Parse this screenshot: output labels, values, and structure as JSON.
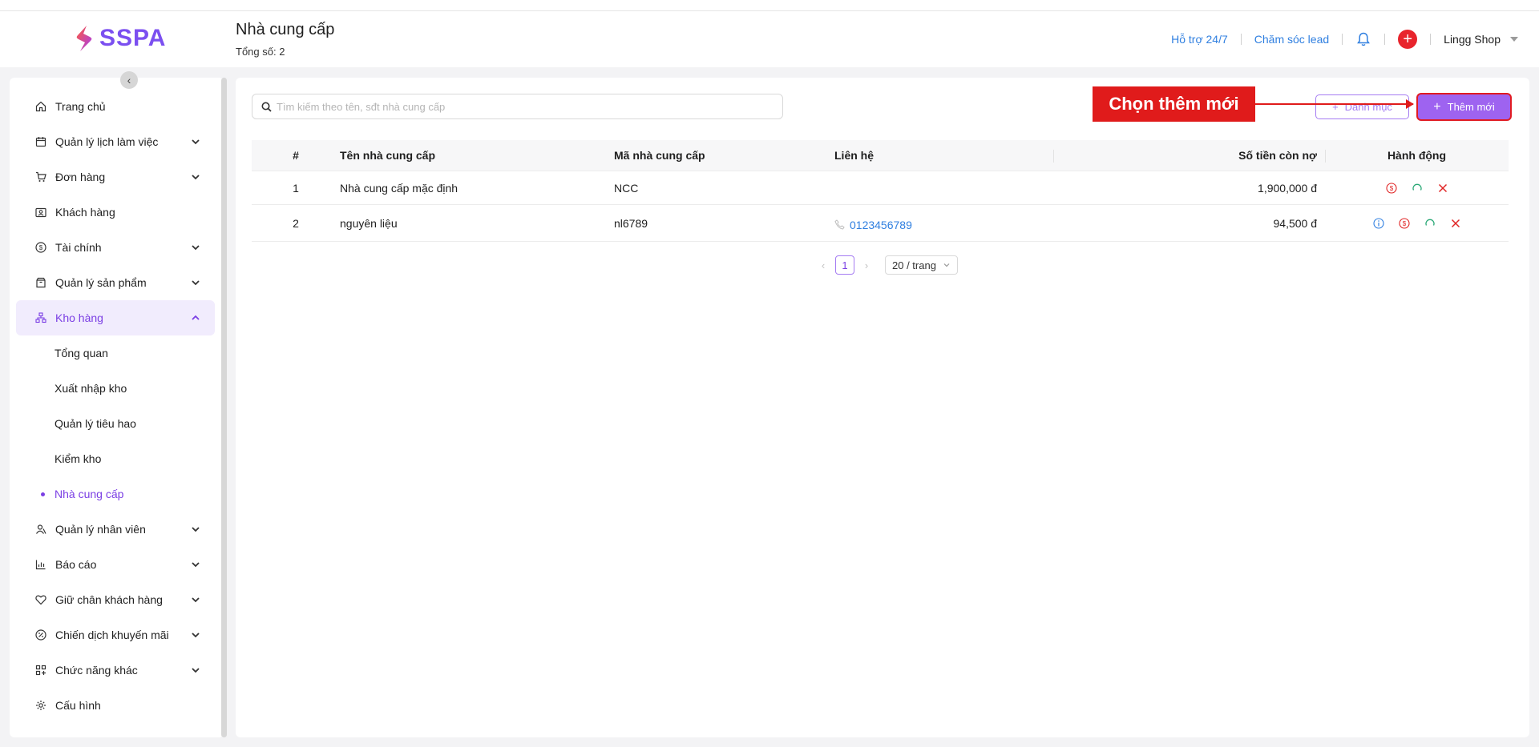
{
  "header": {
    "brand": "SSPA",
    "title": "Nhà cung cấp",
    "subtitle": "Tổng số: 2",
    "support_link": "Hỗ trợ 24/7",
    "lead_link": "Chăm sóc lead",
    "shop_name": "Lingg Shop"
  },
  "sidebar": {
    "items": [
      {
        "label": "Trang chủ",
        "icon": "home-icon"
      },
      {
        "label": "Quản lý lịch làm việc",
        "icon": "calendar-icon"
      },
      {
        "label": "Đơn hàng",
        "icon": "cart-icon"
      },
      {
        "label": "Khách hàng",
        "icon": "customer-card-icon"
      },
      {
        "label": "Tài chính",
        "icon": "dollar-icon"
      },
      {
        "label": "Quản lý sản phẩm",
        "icon": "box-icon"
      },
      {
        "label": "Kho hàng",
        "icon": "warehouse-icon"
      },
      {
        "label": "Quản lý nhân viên",
        "icon": "staff-icon"
      },
      {
        "label": "Báo cáo",
        "icon": "chart-icon"
      },
      {
        "label": "Giữ chân khách hàng",
        "icon": "heart-icon"
      },
      {
        "label": "Chiến dịch khuyến mãi",
        "icon": "discount-icon"
      },
      {
        "label": "Chức năng khác",
        "icon": "grid-icon"
      },
      {
        "label": "Cấu hình",
        "icon": "settings-icon"
      }
    ],
    "warehouse_sub": [
      {
        "label": "Tổng quan"
      },
      {
        "label": "Xuất nhập kho"
      },
      {
        "label": "Quản lý tiêu hao"
      },
      {
        "label": "Kiểm kho"
      },
      {
        "label": "Nhà cung cấp"
      }
    ]
  },
  "toolbar": {
    "search_placeholder": "Tìm kiếm theo tên, sđt nhà cung cấp",
    "category_label": "Danh mục",
    "add_label": "Thêm mới",
    "callout": "Chọn thêm mới"
  },
  "table": {
    "columns": [
      "#",
      "Tên nhà cung cấp",
      "Mã nhà cung cấp",
      "Liên hệ",
      "Số tiền còn nợ",
      "Hành động"
    ],
    "rows": [
      {
        "no": "1",
        "name": "Nhà cung cấp mặc định",
        "code": "NCC",
        "contact": "",
        "debt": "1,900,000 đ"
      },
      {
        "no": "2",
        "name": "nguyên liệu",
        "code": "nl6789",
        "contact": "0123456789",
        "debt": "94,500 đ"
      }
    ]
  },
  "pagination": {
    "current_page": "1",
    "page_size": "20 / trang"
  },
  "colors": {
    "brand": "#7b4ff0",
    "accent": "#9e63f0",
    "callout": "#e01b1b",
    "link": "#2f7fe0"
  }
}
